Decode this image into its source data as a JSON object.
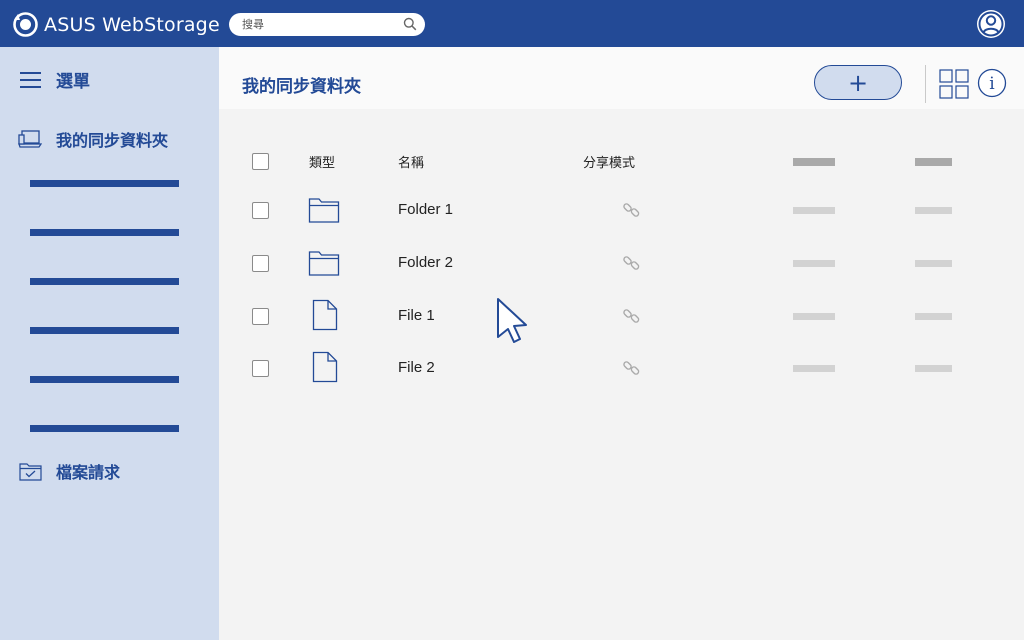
{
  "app": {
    "title": "ASUS WebStorage",
    "colors": {
      "brand": "#234a96",
      "sidebar": "#d1dcee",
      "background": "#f3f3f3"
    }
  },
  "search": {
    "placeholder": "搜尋",
    "value": "",
    "icon": "search-icon"
  },
  "sidebar": {
    "menu_label": "選單",
    "sync_folder_label": "我的同步資料夾",
    "file_request_label": "檔案請求",
    "sub_item_count_visible": 6
  },
  "main": {
    "title": "我的同步資料夾",
    "add_button_label": "+",
    "view_toggle_icon": "grid-view-icon",
    "info_icon": "info-icon",
    "info_glyph": "i"
  },
  "table": {
    "headers": {
      "type": "類型",
      "name": "名稱",
      "share": "分享模式"
    },
    "rows": [
      {
        "type": "folder",
        "name": "Folder 1",
        "share_icon": "link-icon"
      },
      {
        "type": "folder",
        "name": "Folder 2",
        "share_icon": "link-icon"
      },
      {
        "type": "file",
        "name": "File 1",
        "share_icon": "link-icon"
      },
      {
        "type": "file",
        "name": "File 2",
        "share_icon": "link-icon"
      }
    ]
  }
}
